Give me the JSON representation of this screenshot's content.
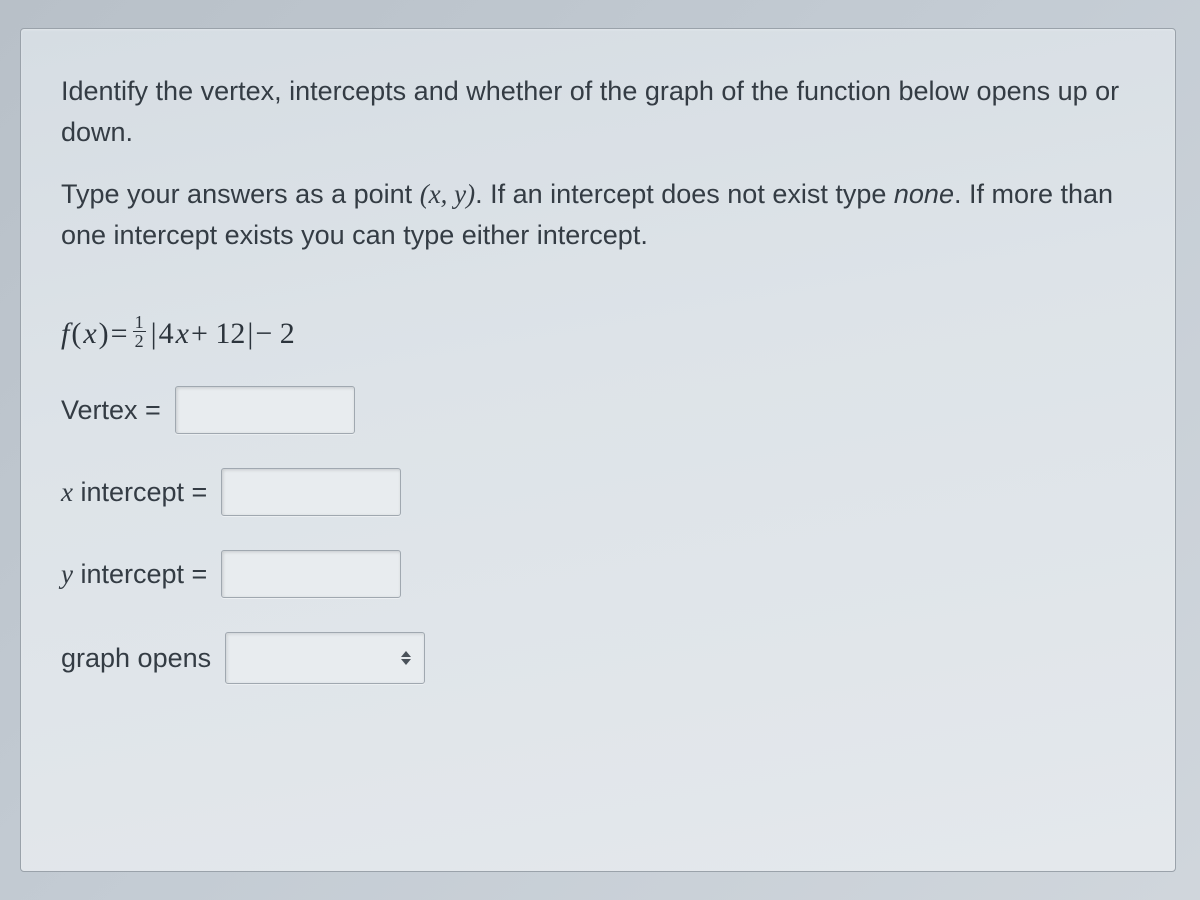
{
  "prompt": {
    "line1": "Identify the vertex, intercepts and whether of the graph of the function below opens up or down.",
    "line2_pre": "Type your answers as a point ",
    "line2_point": "(x, y)",
    "line2_post1": ". If an intercept does not exist type ",
    "line2_none": "none",
    "line2_post2": ". If more than one intercept exists you can type either intercept."
  },
  "equation": {
    "lhs_f": "f",
    "lhs_open": "(",
    "lhs_x": "x",
    "lhs_close": ")",
    "eq": " = ",
    "frac_num": "1",
    "frac_den": "2",
    "abs_open": "|",
    "term_4": "4",
    "term_x": "x",
    "term_plus_12": " + 12",
    "abs_close": "|",
    "tail": " − 2"
  },
  "fields": {
    "vertex": {
      "label": "Vertex =",
      "value": ""
    },
    "x_intercept": {
      "var": "x",
      "label": " intercept =",
      "value": ""
    },
    "y_intercept": {
      "var": "y",
      "label": " intercept =",
      "value": ""
    },
    "graph_opens": {
      "label": "graph opens",
      "selected": ""
    }
  }
}
